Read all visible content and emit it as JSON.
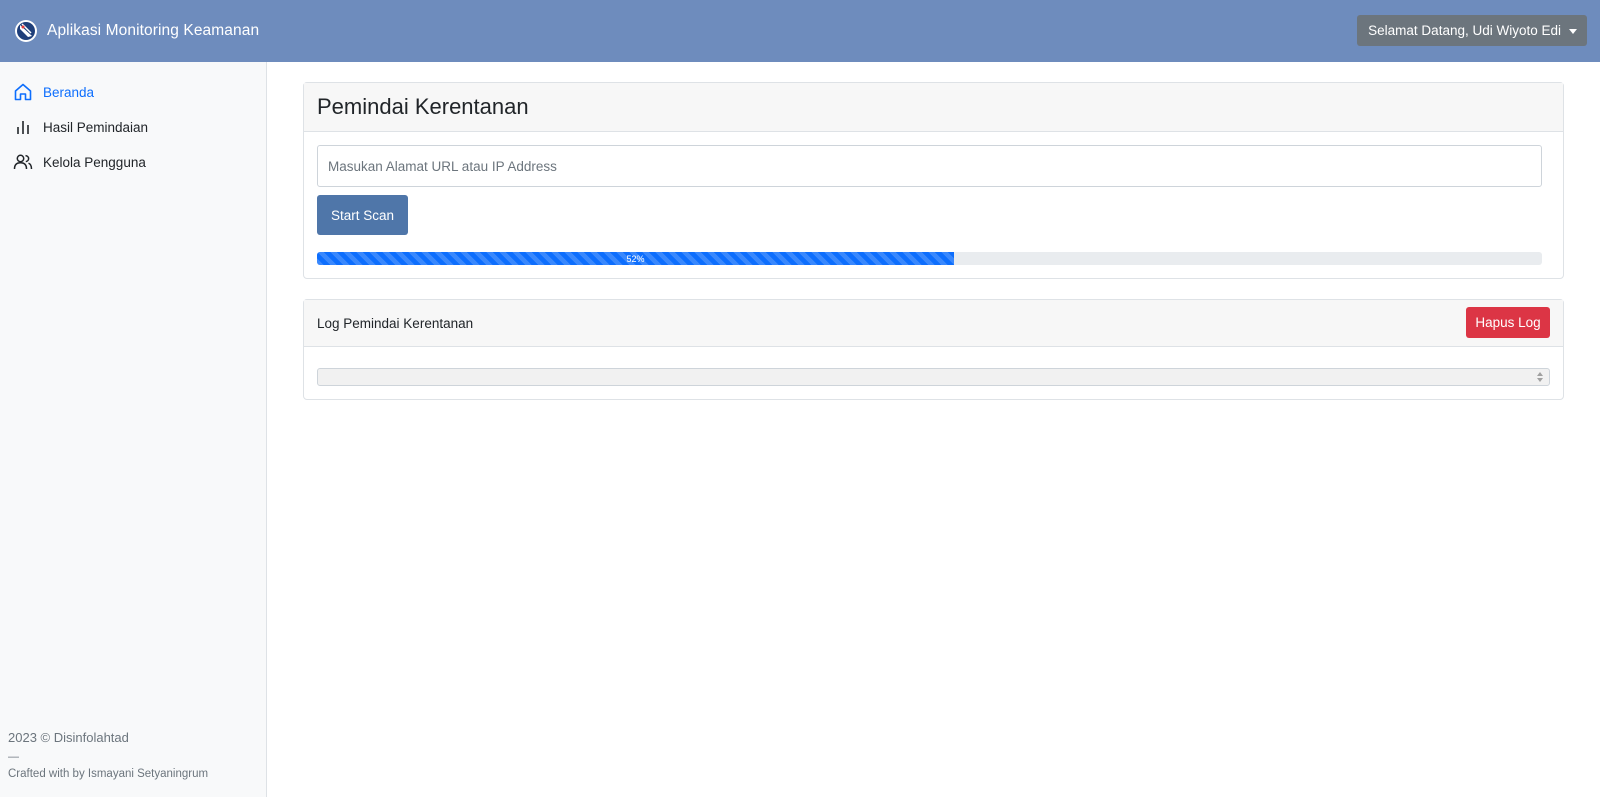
{
  "app": {
    "title": "Aplikasi Monitoring Keamanan",
    "logo_icon": "satellite-dish-icon"
  },
  "header": {
    "user_menu_label": "Selamat Datang, Udi Wiyoto Edi",
    "user_menu_icon": "caret-down-icon"
  },
  "sidebar": {
    "items": [
      {
        "label": "Beranda",
        "icon": "home-icon",
        "active": true
      },
      {
        "label": "Hasil Pemindaian",
        "icon": "bar-chart-icon",
        "active": false
      },
      {
        "label": "Kelola Pengguna",
        "icon": "users-icon",
        "active": false
      }
    ],
    "footer": {
      "year_text": "2023 © Disinfolahtad",
      "divider": "—",
      "credit_text": "Crafted with by Ismayani Setyaningrum"
    }
  },
  "scanner": {
    "title": "Pemindai Kerentanan",
    "input_placeholder": "Masukan Alamat URL atau IP Address",
    "input_value": "",
    "start_label": "Start Scan",
    "progress_percent": 52,
    "progress_label": "52%"
  },
  "log": {
    "title": "Log Pemindai Kerentanan",
    "clear_label": "Hapus Log",
    "content": ""
  },
  "colors": {
    "topbar": "#6e8cbd",
    "primary": "#0d6efd",
    "start_button": "#4f76a9",
    "danger": "#dc3545",
    "user_menu": "#6c757d"
  }
}
